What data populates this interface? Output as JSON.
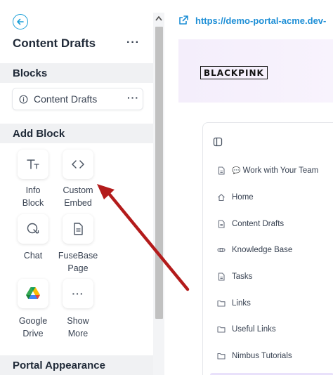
{
  "sidebar": {
    "title": "Content Drafts",
    "more_label": "···",
    "blocks_heading": "Blocks",
    "block_item": {
      "label": "Content Drafts",
      "icon": "info-icon",
      "more_label": "···"
    },
    "add_block_heading": "Add Block",
    "tiles": [
      {
        "label_line1": "Info",
        "label_line2": "Block",
        "icon": "text-format-icon"
      },
      {
        "label_line1": "Custom",
        "label_line2": "Embed",
        "icon": "code-icon"
      },
      {
        "label_line1": "Chat",
        "label_line2": "",
        "icon": "chat-icon"
      },
      {
        "label_line1": "FuseBase",
        "label_line2": "Page",
        "icon": "document-icon"
      },
      {
        "label_line1": "Google",
        "label_line2": "Drive",
        "icon": "google-drive-icon"
      },
      {
        "label_line1": "Show",
        "label_line2": "More",
        "icon": "more-icon",
        "glyph": "···"
      }
    ],
    "portal_heading": "Portal Appearance"
  },
  "preview": {
    "url": "https://demo-portal-acme.dev-",
    "logo_text": "BLACKPINK",
    "nav": [
      {
        "label": "Work with Your Team",
        "icon": "document-icon",
        "prefix": "💬"
      },
      {
        "label": "Home",
        "icon": "home-icon"
      },
      {
        "label": "Content Drafts",
        "icon": "document-icon"
      },
      {
        "label": "Knowledge Base",
        "icon": "link-chain-icon"
      },
      {
        "label": "Tasks",
        "icon": "document-icon"
      },
      {
        "label": "Links",
        "icon": "folder-icon"
      },
      {
        "label": "Useful Links",
        "icon": "folder-icon"
      },
      {
        "label": "Nimbus Tutorials",
        "icon": "folder-icon"
      }
    ]
  },
  "colors": {
    "accent": "#1ca0d8",
    "link": "#1e8fd6",
    "arrow": "#b31b1b",
    "band": "#f0f1f3"
  }
}
